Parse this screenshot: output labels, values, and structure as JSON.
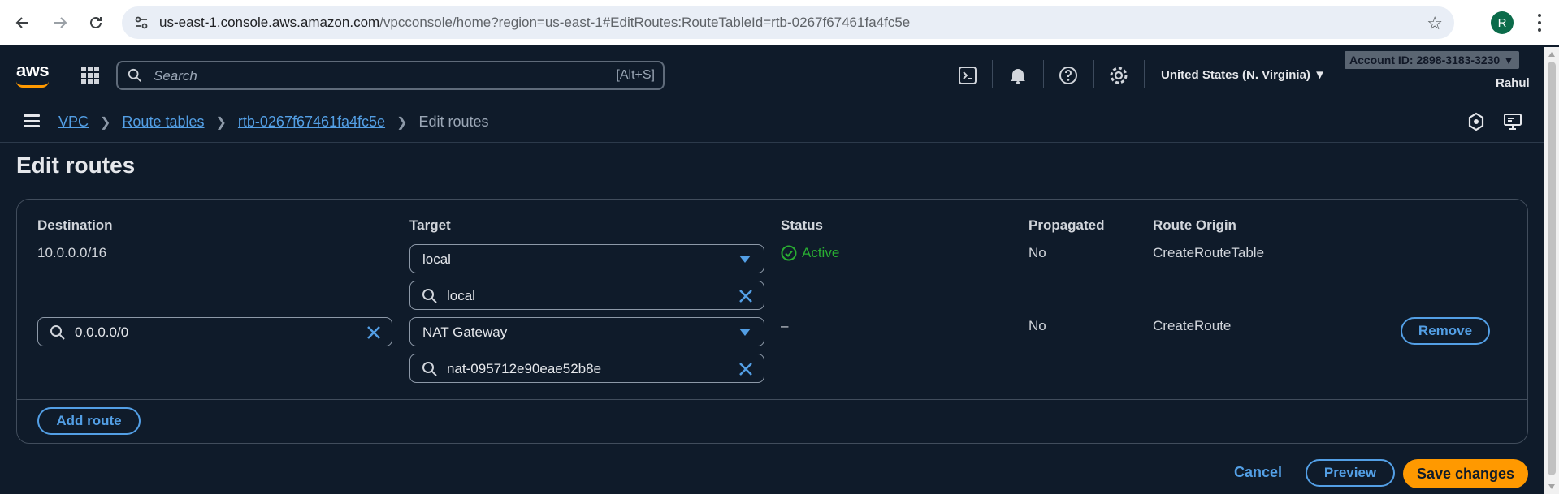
{
  "browser": {
    "url_domain": "us-east-1.console.aws.amazon.com",
    "url_path": "/vpcconsole/home?region=us-east-1#EditRoutes:RouteTableId=rtb-0267f67461fa4fc5e",
    "profile_initial": "R"
  },
  "topnav": {
    "logo": "aws",
    "search_placeholder": "Search",
    "search_shortcut": "[Alt+S]",
    "region": "United States (N. Virginia) ▼",
    "account": "Account ID: 2898-3183-3230 ▼",
    "user": "Rahul"
  },
  "breadcrumb": {
    "items": [
      "VPC",
      "Route tables",
      "rtb-0267f67461fa4fc5e"
    ],
    "current": "Edit routes"
  },
  "page": {
    "title": "Edit routes"
  },
  "table": {
    "columns": [
      "Destination",
      "Target",
      "Status",
      "Propagated",
      "Route Origin"
    ],
    "rows": [
      {
        "destination": "10.0.0.0/16",
        "target_type": "local",
        "target_filter": "local",
        "status": "Active",
        "propagated": "No",
        "origin": "CreateRouteTable"
      },
      {
        "destination": "0.0.0.0/0",
        "target_type": "NAT Gateway",
        "target_filter": "nat-095712e90eae52b8e",
        "status": "–",
        "propagated": "No",
        "origin": "CreateRoute",
        "remove_label": "Remove"
      }
    ],
    "add_route_label": "Add route"
  },
  "footer": {
    "cancel_label": "Cancel",
    "preview_label": "Preview",
    "save_label": "Save changes"
  },
  "colors": {
    "accent": "#539fe5",
    "primary": "#ff9900",
    "success": "#29ad32",
    "background": "#0f1b2a"
  }
}
